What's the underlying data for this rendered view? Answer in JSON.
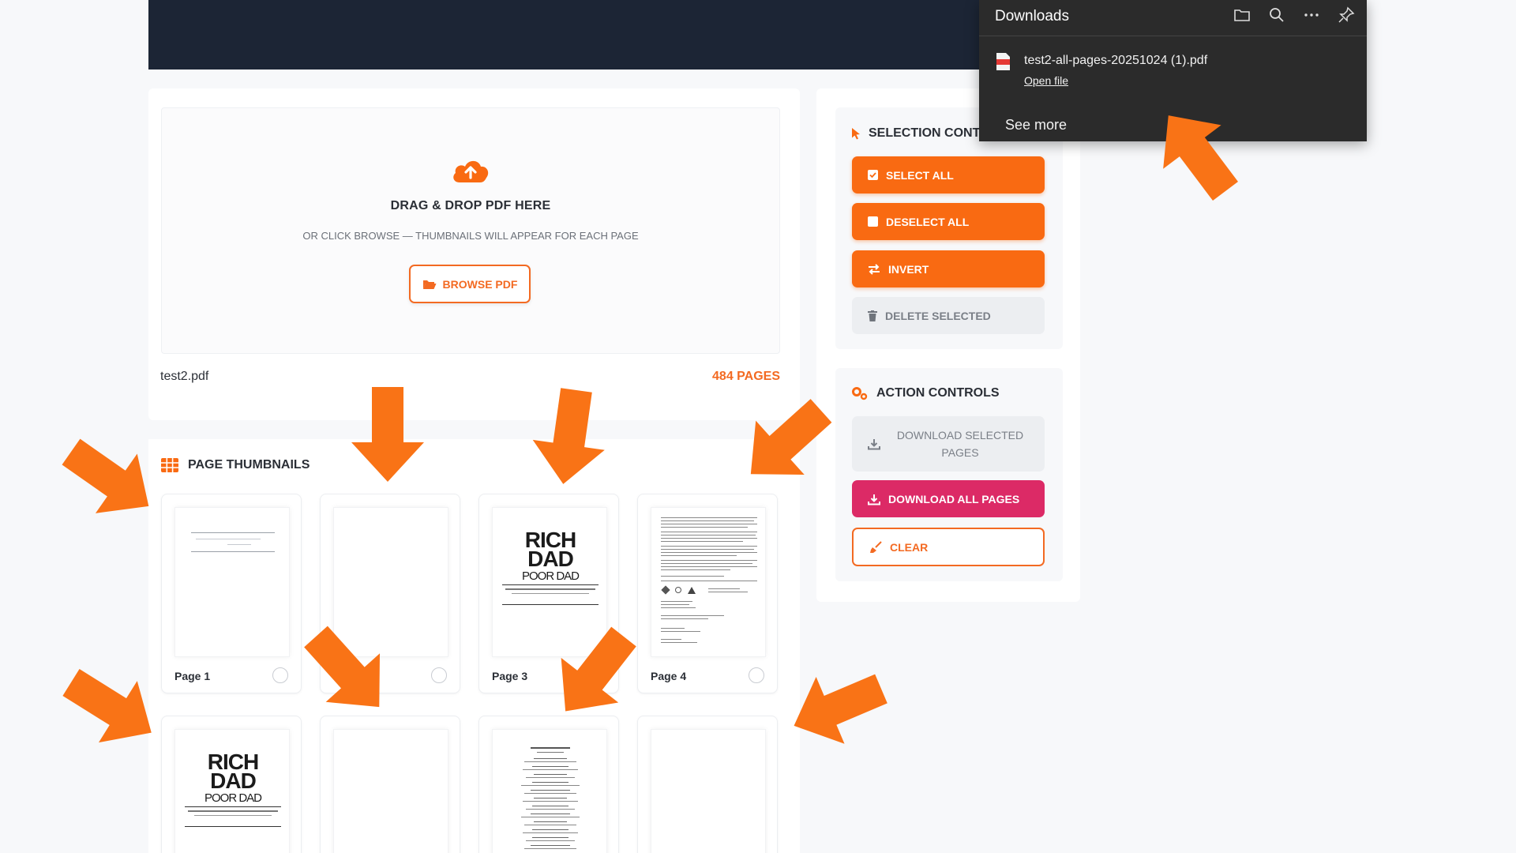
{
  "upload": {
    "title": "DRAG & DROP PDF HERE",
    "subtitle": "OR CLICK BROWSE — THUMBNAILS WILL APPEAR FOR EACH PAGE",
    "browse_label": "BROWSE PDF",
    "file_name": "test2.pdf",
    "page_count": "484 PAGES"
  },
  "thumbnails": {
    "title": "PAGE THUMBNAILS",
    "pages": [
      {
        "label": "Page 1"
      },
      {
        "label": ""
      },
      {
        "label": "Page 3"
      },
      {
        "label": "Page 4"
      }
    ],
    "cover_text": {
      "line1": "RICH",
      "line2": "DAD",
      "line3": "POOR DAD"
    }
  },
  "selection": {
    "title": "SELECTION CONT",
    "select_all": "SELECT ALL",
    "deselect_all": "DESELECT ALL",
    "invert": "INVERT",
    "delete_selected": "DELETE SELECTED"
  },
  "actions": {
    "title": "ACTION CONTROLS",
    "download_selected_line1": "DOWNLOAD SELECTED",
    "download_selected_line2": "PAGES",
    "download_all": "DOWNLOAD ALL PAGES",
    "clear": "CLEAR"
  },
  "downloads": {
    "title": "Downloads",
    "file_name": "test2-all-pages-20251024 (1).pdf",
    "open_file": "Open file",
    "see_more": "See more"
  },
  "colors": {
    "accent": "#f96a12",
    "pink": "#dc2a66",
    "navy": "#1c2535",
    "arrow": "#f97316"
  }
}
